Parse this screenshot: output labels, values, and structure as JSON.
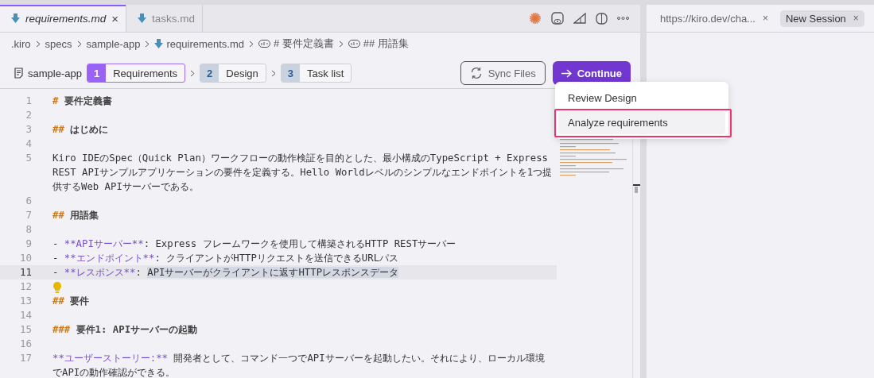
{
  "editor_tabs": [
    {
      "label": "requirements.md",
      "selected": true,
      "close": "×"
    },
    {
      "label": "tasks.md",
      "selected": false
    }
  ],
  "breadcrumbs": [
    {
      "kind": "folder",
      "text": ".kiro"
    },
    {
      "kind": "folder",
      "text": "specs"
    },
    {
      "kind": "folder",
      "text": "sample-app"
    },
    {
      "kind": "file",
      "text": "requirements.md"
    },
    {
      "kind": "symbol",
      "text": "# 要件定義書"
    },
    {
      "kind": "symbol",
      "text": "## 用語集"
    }
  ],
  "spec": {
    "name": "sample-app",
    "steps": [
      {
        "number": "1",
        "label": "Requirements",
        "selected": true
      },
      {
        "number": "2",
        "label": "Design",
        "selected": false
      },
      {
        "number": "3",
        "label": "Task list",
        "selected": false
      }
    ]
  },
  "buttons": {
    "sync": "Sync Files",
    "continue": "Continue"
  },
  "menu": [
    {
      "label": "Review Design",
      "selected": false,
      "annotated": false
    },
    {
      "label": "Analyze requirements",
      "selected": true,
      "annotated": true
    }
  ],
  "lines": [
    {
      "number": "1",
      "current": false,
      "segments": [
        {
          "kind": "hash",
          "text": "#"
        },
        {
          "kind": "heading",
          "text": " 要件定義書"
        }
      ]
    },
    {
      "number": "2",
      "current": false
    },
    {
      "number": "3",
      "current": false,
      "segments": [
        {
          "kind": "hash",
          "text": "##"
        },
        {
          "kind": "heading",
          "text": " はじめに"
        }
      ]
    },
    {
      "number": "4",
      "current": false
    },
    {
      "number": "5",
      "current": false,
      "segments": [
        {
          "kind": "text",
          "text": "Kiro IDEのSpec（Quick Plan）ワークフローの動作検証を目的とした、最小構成のTypeScript + Express REST APIサンプルアプリケーションの要件を定義する。Hello Worldレベルのシンプルなエンドポイントを1つ提供するWeb APIサーバーである。"
        }
      ]
    },
    {
      "number": "6",
      "current": false
    },
    {
      "number": "7",
      "current": false,
      "segments": [
        {
          "kind": "hash",
          "text": "##"
        },
        {
          "kind": "heading",
          "text": " 用語集"
        }
      ]
    },
    {
      "number": "8",
      "current": false
    },
    {
      "number": "9",
      "current": false,
      "segments": [
        {
          "kind": "text",
          "text": "- "
        },
        {
          "kind": "strong",
          "text": "**APIサーバー**"
        },
        {
          "kind": "text",
          "text": ": Express フレームワークを使用して構築されるHTTP RESTサーバー"
        }
      ]
    },
    {
      "number": "10",
      "current": false,
      "segments": [
        {
          "kind": "text",
          "text": "- "
        },
        {
          "kind": "strong",
          "text": "**エンドポイント**"
        },
        {
          "kind": "text",
          "text": ": クライアントがHTTPリクエストを送信できるURLパス"
        }
      ]
    },
    {
      "number": "11",
      "current": true,
      "segments": [
        {
          "kind": "text",
          "text": "- "
        },
        {
          "kind": "strong",
          "text": "**レスポンス**"
        },
        {
          "kind": "text",
          "text": ": "
        },
        {
          "kind": "selection",
          "text": "APIサーバーがクライアントに返すHTTPレスポンスデータ"
        }
      ]
    },
    {
      "number": "12",
      "current": false,
      "segments": [
        {
          "kind": "lightbulb"
        }
      ]
    },
    {
      "number": "13",
      "current": false,
      "segments": [
        {
          "kind": "hash",
          "text": "##"
        },
        {
          "kind": "heading",
          "text": " 要件"
        }
      ]
    },
    {
      "number": "14",
      "current": false
    },
    {
      "number": "15",
      "current": false,
      "segments": [
        {
          "kind": "hash",
          "text": "###"
        },
        {
          "kind": "heading",
          "text": " 要件1: APIサーバーの起動"
        }
      ]
    },
    {
      "number": "16",
      "current": false
    },
    {
      "number": "17",
      "current": false,
      "segments": [
        {
          "kind": "strong",
          "text": "**ユーザーストーリー:**"
        },
        {
          "kind": "text",
          "text": " 開発者として、コマンド一つでAPIサーバーを起動したい。それにより、ローカル環境でAPIの動作確認ができる。"
        }
      ]
    }
  ],
  "side_tabs": [
    {
      "label": "https://kiro.dev/cha...",
      "selected": false,
      "close": "×"
    },
    {
      "label": "New Session",
      "selected": true,
      "close": "×"
    }
  ]
}
